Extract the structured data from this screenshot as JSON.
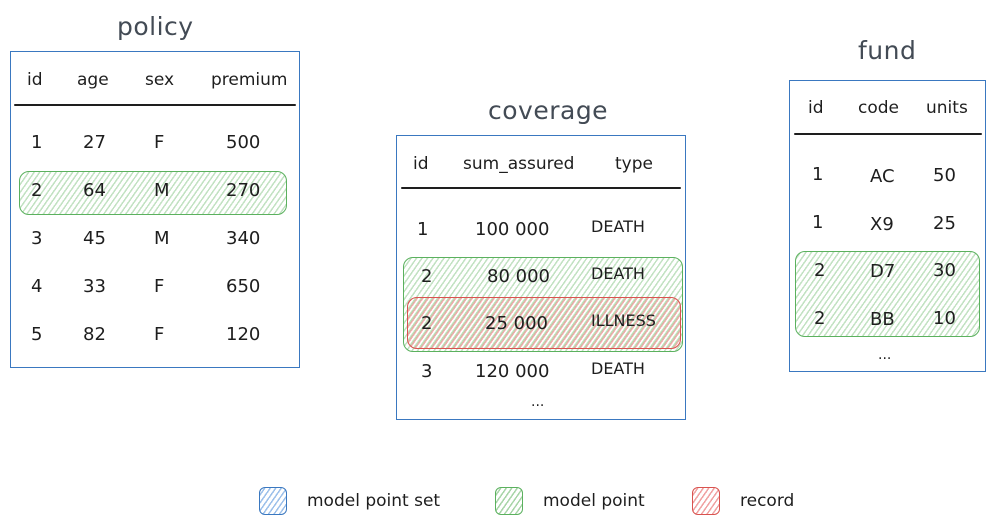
{
  "colors": {
    "model_point_set": "#3a78c0",
    "model_point": "#5bb15e",
    "record": "#d9534f",
    "title_text": "#434b55"
  },
  "policy": {
    "title": "policy",
    "columns": [
      "id",
      "age",
      "sex",
      "premium"
    ],
    "rows": [
      [
        "1",
        "27",
        "F",
        "500"
      ],
      [
        "2",
        "64",
        "M",
        "270"
      ],
      [
        "3",
        "45",
        "M",
        "340"
      ],
      [
        "4",
        "33",
        "F",
        "650"
      ],
      [
        "5",
        "82",
        "F",
        "120"
      ]
    ],
    "highlight": {
      "type": "model point",
      "rows": [
        1
      ]
    }
  },
  "coverage": {
    "title": "coverage",
    "columns": [
      "id",
      "sum_assured",
      "type"
    ],
    "rows": [
      [
        "1",
        "100 000",
        "DEATH"
      ],
      [
        "2",
        "80 000",
        "DEATH"
      ],
      [
        "2",
        "25 000",
        "ILLNESS"
      ],
      [
        "3",
        "120 000",
        "DEATH"
      ]
    ],
    "ellipsis": "...",
    "highlights": [
      {
        "type": "model point",
        "rows": [
          1,
          2
        ]
      },
      {
        "type": "record",
        "rows": [
          2
        ]
      }
    ]
  },
  "fund": {
    "title": "fund",
    "columns": [
      "id",
      "code",
      "units"
    ],
    "rows": [
      [
        "1",
        "AC",
        "50"
      ],
      [
        "1",
        "X9",
        "25"
      ],
      [
        "2",
        "D7",
        "30"
      ],
      [
        "2",
        "BB",
        "10"
      ]
    ],
    "ellipsis": "...",
    "highlight": {
      "type": "model point",
      "rows": [
        2,
        3
      ]
    }
  },
  "legend": [
    {
      "icon": "blue-hatched-square",
      "label": "model point set"
    },
    {
      "icon": "green-hatched-square",
      "label": "model point"
    },
    {
      "icon": "red-hatched-square",
      "label": "record"
    }
  ]
}
